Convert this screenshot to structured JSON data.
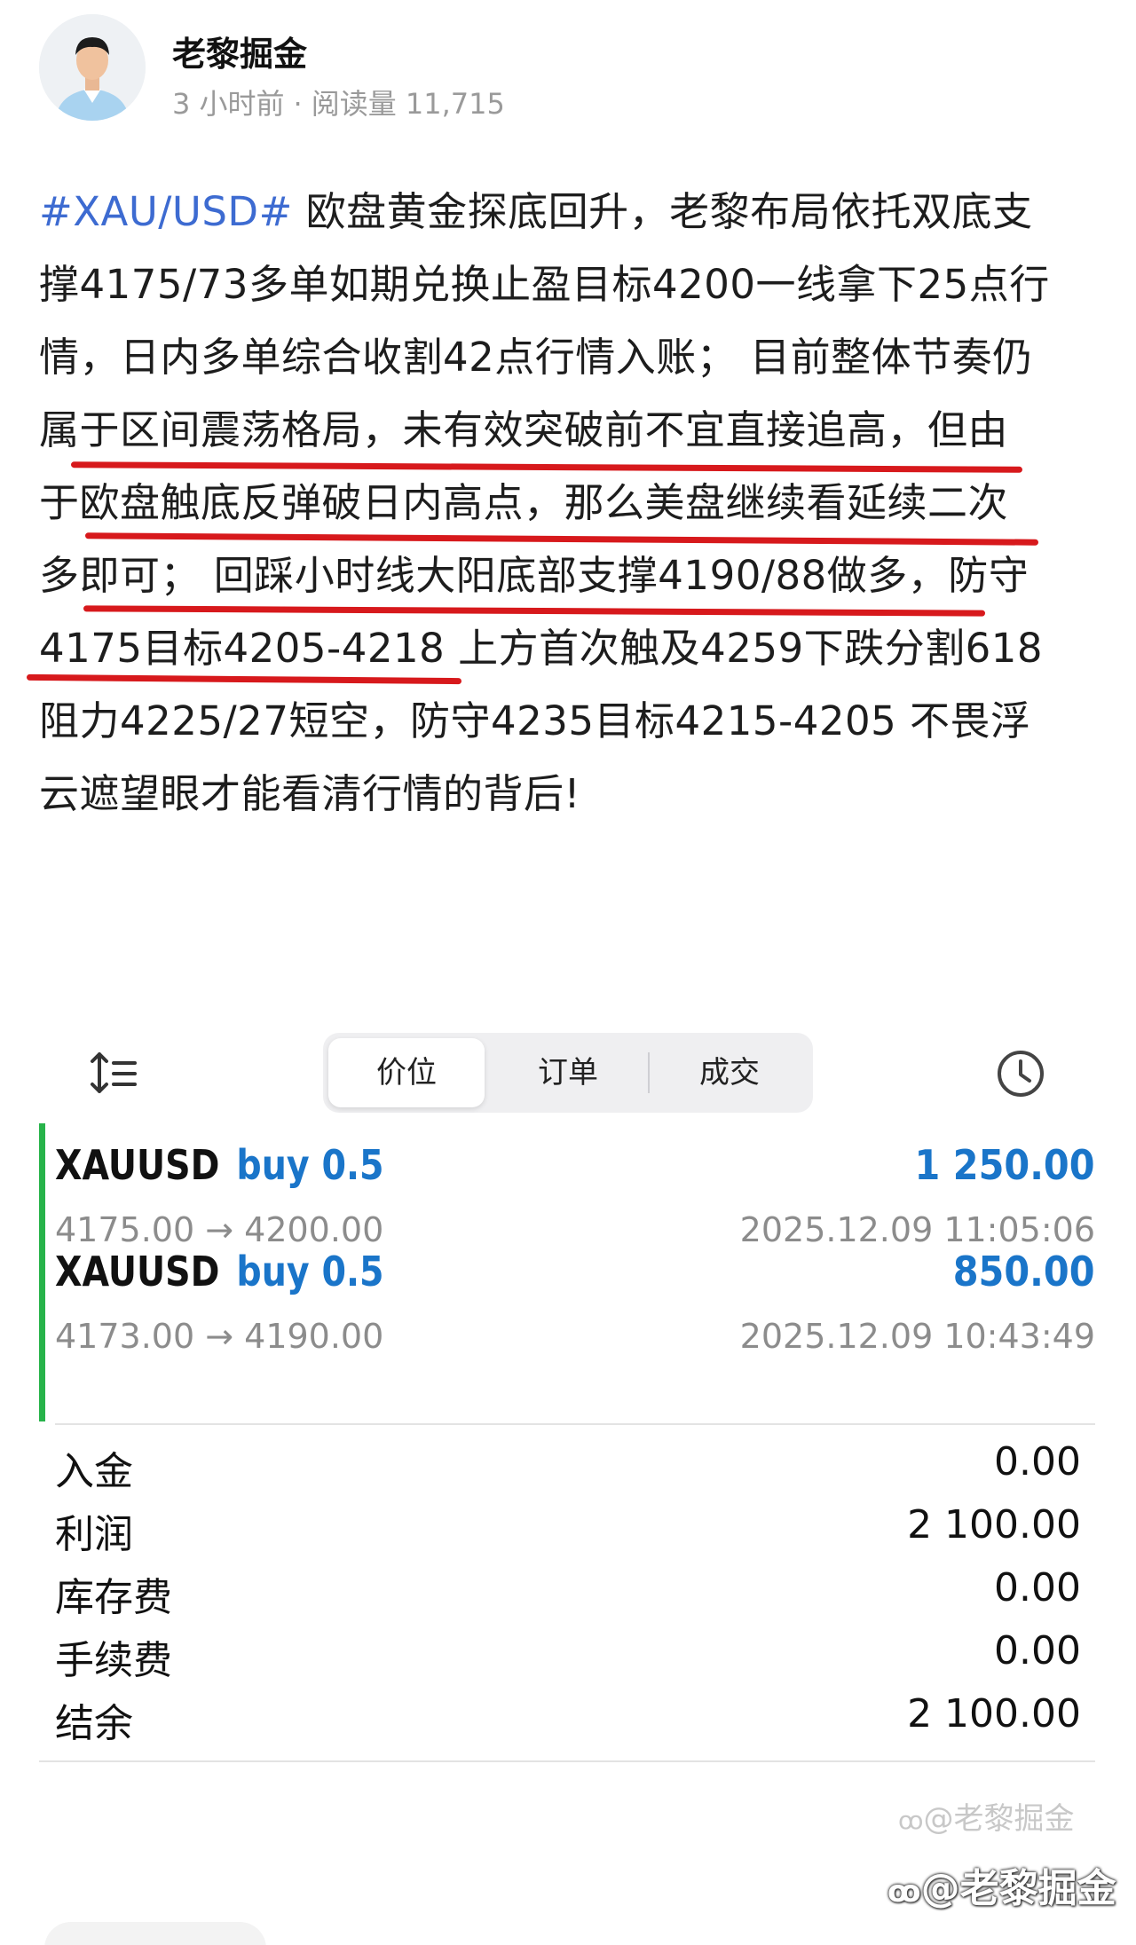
{
  "header": {
    "author": "老黎掘金",
    "time_ago": "3 小时前",
    "separator": "·",
    "reads_label": "阅读量",
    "reads_count": "11,715"
  },
  "post": {
    "tag": "#XAU/USD#",
    "lines": [
      " 欧盘黄金探底回升，老黎布局依托双底支",
      "撑4175/73多单如期兑换止盈目标4200一线拿下25点行",
      "情，日内多单综合收割42点行情入账； 目前整体节奏仍",
      "属于区间震荡格局，未有效突破前不宜直接追高，但由",
      "于欧盘触底反弹破日内高点，那么美盘继续看延续二次",
      "多即可； 回踩小时线大阳底部支撑4190/88做多，防守",
      "4175目标4205-4218 上方首次触及4259下跌分割618",
      "阻力4225/27短空，防守4235目标4215-4205 不畏浮",
      "云遮望眼才能看清行情的背后!"
    ],
    "underline_color": "#d7191c"
  },
  "tabs": {
    "items": [
      "价位",
      "订单",
      "成交"
    ],
    "active": "价位"
  },
  "icons": {
    "sort": "sort-icon",
    "history": "clock-icon"
  },
  "trades": [
    {
      "symbol": "XAUUSD",
      "action": "buy 0.5",
      "profit": "1 250.00",
      "prices": "4175.00 → 4200.00",
      "time": "2025.12.09 11:05:06"
    },
    {
      "symbol": "XAUUSD",
      "action": "buy 0.5",
      "profit": "850.00",
      "prices": "4173.00 → 4190.00",
      "time": "2025.12.09 10:43:49"
    }
  ],
  "summary": [
    {
      "label": "入金",
      "value": "0.00"
    },
    {
      "label": "利润",
      "value": "2 100.00"
    },
    {
      "label": "库存费",
      "value": "0.00"
    },
    {
      "label": "手续费",
      "value": "0.00"
    },
    {
      "label": "结余",
      "value": "2 100.00"
    }
  ],
  "watermark": {
    "small": "@老黎掘金",
    "large": "@老黎掘金"
  },
  "colors": {
    "accent_blue": "#1a75c9",
    "hashtag_blue": "#3d6bd1",
    "buy_bar_green": "#27b34a",
    "underline_red": "#d7191c"
  }
}
